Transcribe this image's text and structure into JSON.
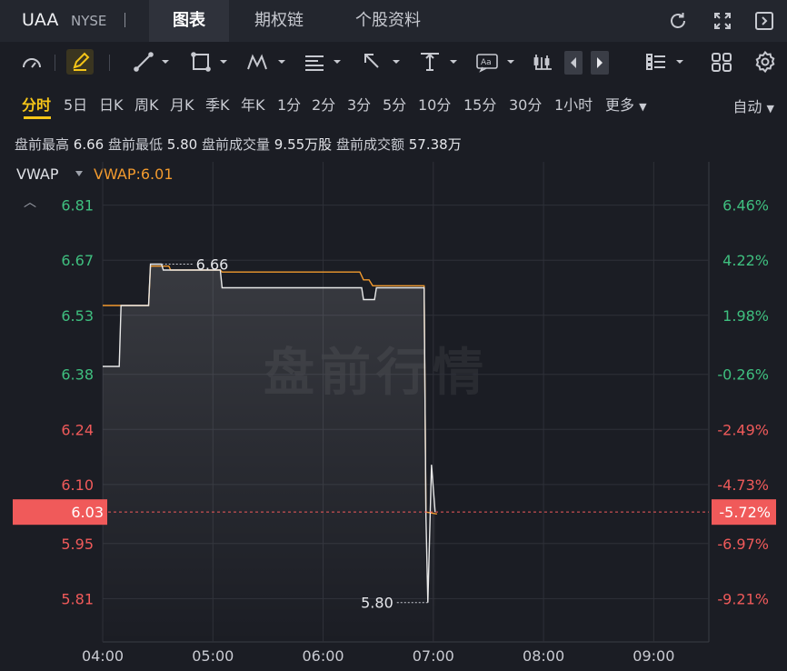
{
  "header": {
    "ticker": "UAA",
    "exchange": "NYSE",
    "tabs": [
      "图表",
      "期权链",
      "个股资料"
    ],
    "icons": [
      "refresh-icon",
      "fullscreen-icon",
      "collapse-panel-icon"
    ]
  },
  "toolbar": {
    "tools": [
      "gauge-icon",
      "pen-icon",
      "trendline-icon",
      "rectangle-icon",
      "wave-pattern-icon",
      "fibonacci-icon",
      "arrow-icon",
      "vertical-measure-icon",
      "text-annotation-icon",
      "candlestick-icon",
      "prev-icon",
      "next-icon",
      "layout-list-icon",
      "grid-layout-icon",
      "settings-icon"
    ]
  },
  "periods": {
    "items": [
      "分时",
      "5日",
      "日K",
      "周K",
      "月K",
      "季K",
      "年K",
      "1分",
      "2分",
      "3分",
      "5分",
      "10分",
      "15分",
      "30分",
      "1小时",
      "更多"
    ],
    "active": "分时",
    "mode": "自动"
  },
  "stats": {
    "high_label": "盘前最高",
    "high": "6.66",
    "low_label": "盘前最低",
    "low": "5.80",
    "volume_label": "盘前成交量",
    "volume": "9.55万股",
    "amount_label": "盘前成交额",
    "amount": "57.38万"
  },
  "indicator": {
    "name": "VWAP",
    "value_text": "VWAP:6.01"
  },
  "watermark": "盘前行情",
  "colors": {
    "up": "#3fbf7f",
    "down": "#f05a5a",
    "vwap": "#f29a2e",
    "price": "#e8e8e8",
    "accent": "#f5c518"
  },
  "chart_data": {
    "type": "line",
    "x_ticks": [
      "04:00",
      "05:00",
      "06:00",
      "07:00",
      "08:00",
      "09:00"
    ],
    "y_ticks": [
      "6.81",
      "6.67",
      "6.53",
      "6.38",
      "6.24",
      "6.10",
      "5.95",
      "5.81"
    ],
    "pct_ticks": [
      "6.46%",
      "4.22%",
      "1.98%",
      "-0.26%",
      "-2.49%",
      "-4.73%",
      "-6.97%",
      "-9.21%"
    ],
    "current_price": "6.03",
    "current_pct": "-5.72%",
    "high_marker": "6.66",
    "low_marker": "5.80",
    "ylim": [
      5.7,
      6.92
    ],
    "series": [
      {
        "name": "VWAP",
        "points": [
          [
            "04:00",
            6.555
          ],
          [
            "04:25",
            6.555
          ],
          [
            "04:26",
            6.655
          ],
          [
            "04:36",
            6.655
          ],
          [
            "04:37",
            6.645
          ],
          [
            "05:04",
            6.645
          ],
          [
            "05:05",
            6.64
          ],
          [
            "06:20",
            6.64
          ],
          [
            "06:22",
            6.62
          ],
          [
            "06:25",
            6.62
          ],
          [
            "06:27",
            6.605
          ],
          [
            "06:55",
            6.605
          ],
          [
            "06:56",
            6.03
          ],
          [
            "07:02",
            6.025
          ]
        ]
      },
      {
        "points": [
          [
            "04:00",
            6.4
          ],
          [
            "04:09",
            6.4
          ],
          [
            "04:10",
            6.555
          ],
          [
            "04:25",
            6.555
          ],
          [
            "04:26",
            6.66
          ],
          [
            "04:32",
            6.66
          ],
          [
            "04:33",
            6.645
          ],
          [
            "05:04",
            6.645
          ],
          [
            "05:05",
            6.6
          ],
          [
            "06:21",
            6.6
          ],
          [
            "06:22",
            6.57
          ],
          [
            "06:28",
            6.57
          ],
          [
            "06:29",
            6.6
          ],
          [
            "06:55",
            6.6
          ],
          [
            "06:56",
            6.02
          ],
          [
            "06:57",
            5.8
          ],
          [
            "06:59",
            6.15
          ],
          [
            "07:01",
            6.03
          ]
        ]
      }
    ]
  }
}
